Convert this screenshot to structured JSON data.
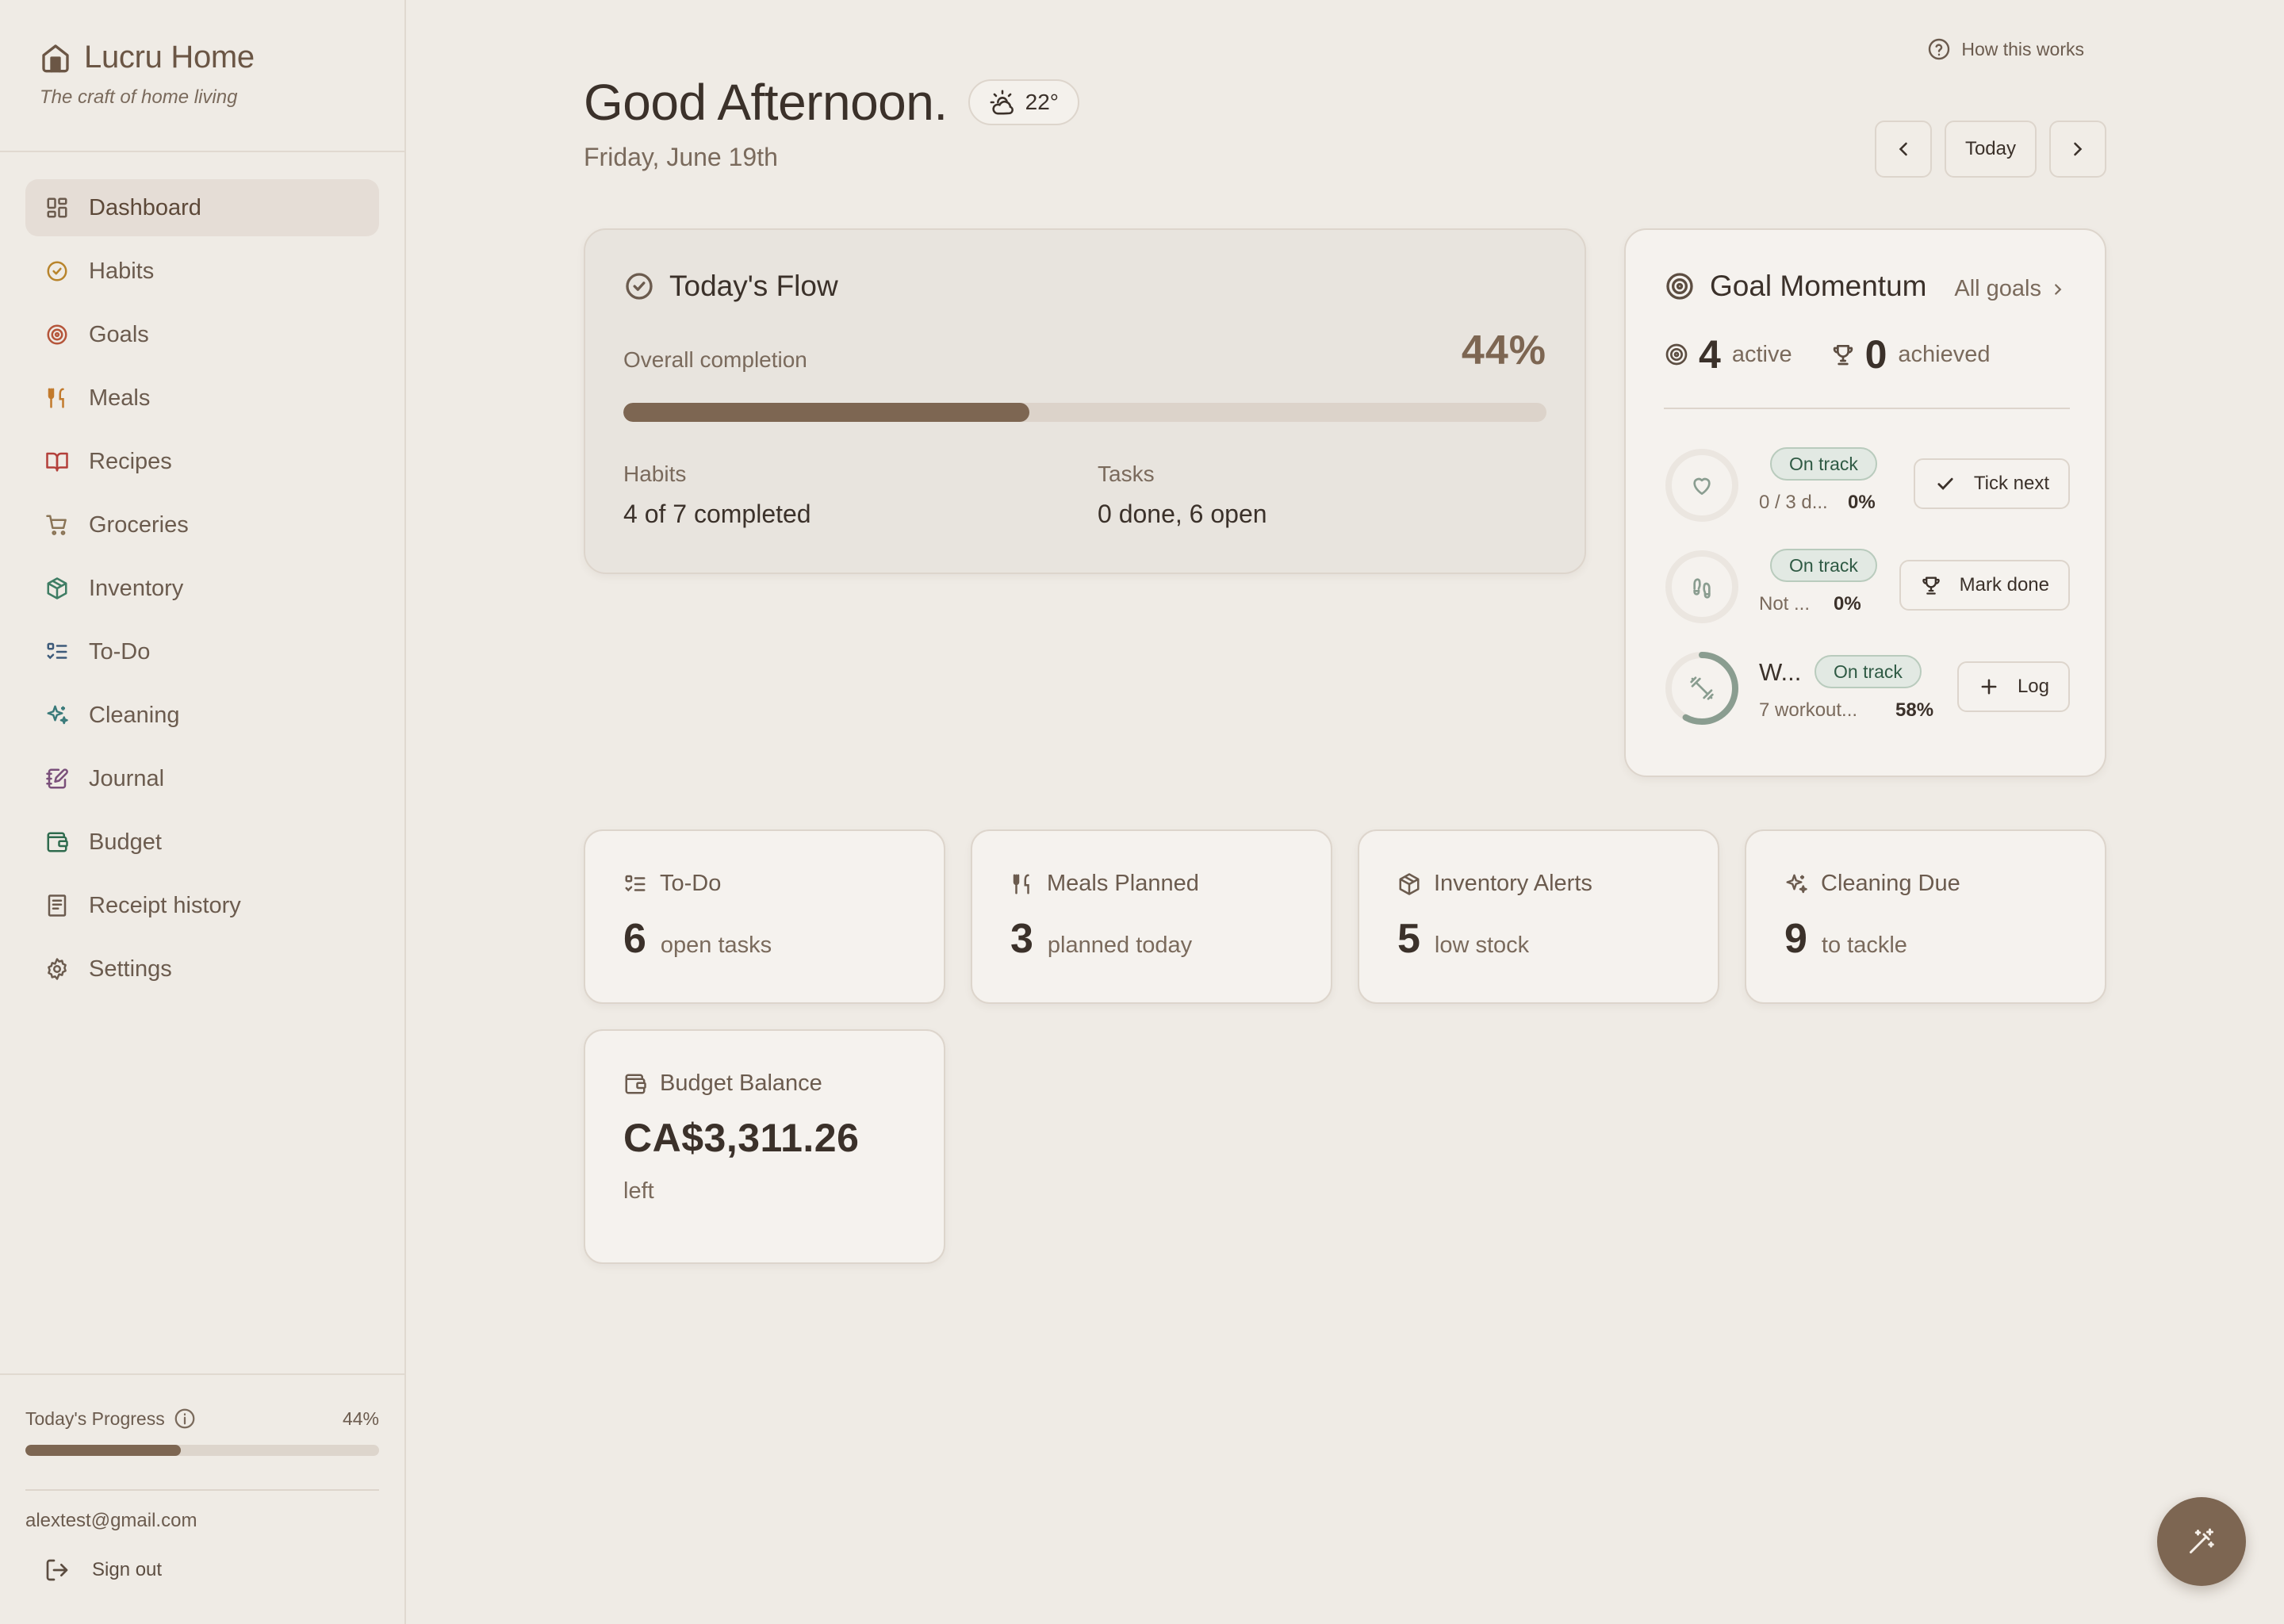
{
  "brand": {
    "title": "Lucru Home",
    "tagline": "The craft of home living"
  },
  "sidebar": {
    "items": [
      {
        "label": "Dashboard",
        "icon": "dashboard-icon"
      },
      {
        "label": "Habits",
        "icon": "circle-check-icon"
      },
      {
        "label": "Goals",
        "icon": "target-icon"
      },
      {
        "label": "Meals",
        "icon": "utensils-icon"
      },
      {
        "label": "Recipes",
        "icon": "book-open-icon"
      },
      {
        "label": "Groceries",
        "icon": "cart-icon"
      },
      {
        "label": "Inventory",
        "icon": "box-icon"
      },
      {
        "label": "To-Do",
        "icon": "list-todo-icon"
      },
      {
        "label": "Cleaning",
        "icon": "sparkles-icon"
      },
      {
        "label": "Journal",
        "icon": "notebook-pen-icon"
      },
      {
        "label": "Budget",
        "icon": "wallet-icon"
      },
      {
        "label": "Receipt history",
        "icon": "receipt-icon"
      },
      {
        "label": "Settings",
        "icon": "gear-icon"
      }
    ],
    "active": "Dashboard",
    "progress": {
      "label": "Today's Progress",
      "percent_text": "44%",
      "value": 0.44
    },
    "email": "alextest@gmail.com",
    "signout": "Sign out"
  },
  "header": {
    "how_this_works": "How this works",
    "greeting": "Good Afternoon.",
    "weather": "22°",
    "date": "Friday, June 19th",
    "today_button": "Today"
  },
  "flow": {
    "title": "Today's Flow",
    "overall_label": "Overall completion",
    "percent_text": "44%",
    "value": 0.44,
    "habits_label": "Habits",
    "habits_value": "4 of 7 completed",
    "tasks_label": "Tasks",
    "tasks_value": "0 done, 6 open"
  },
  "goals": {
    "title": "Goal Momentum",
    "all_goals": "All goals",
    "active_count": "4",
    "active_label": "active",
    "achieved_count": "0",
    "achieved_label": "achieved",
    "items": [
      {
        "badge": "On track",
        "sub": "0 / 3 d...",
        "pct": "0%",
        "progress": 0,
        "button": "Tick next",
        "icon": "heart-icon",
        "btn_icon": "check-icon"
      },
      {
        "badge": "On track",
        "sub": "Not ...",
        "pct": "0%",
        "progress": 0,
        "button": "Mark done",
        "icon": "footprints-icon",
        "btn_icon": "trophy-icon"
      },
      {
        "title": "W...",
        "badge": "On track",
        "sub": "7 workout...",
        "pct": "58%",
        "progress": 0.58,
        "button": "Log",
        "icon": "dumbbell-icon",
        "btn_icon": "plus-icon"
      }
    ]
  },
  "cards": {
    "todo": {
      "title": "To-Do",
      "value": "6",
      "unit": "open tasks"
    },
    "meals": {
      "title": "Meals Planned",
      "value": "3",
      "unit": "planned today"
    },
    "inventory": {
      "title": "Inventory Alerts",
      "value": "5",
      "unit": "low stock"
    },
    "cleaning": {
      "title": "Cleaning Due",
      "value": "9",
      "unit": "to tackle"
    },
    "budget": {
      "title": "Budget Balance",
      "value": "CA$3,311.26",
      "unit": "left"
    }
  },
  "colors": {
    "accent": "#7d6652",
    "background": "#efebe5",
    "card": "#f5f2ee",
    "badge_green": "#2f5a44"
  }
}
